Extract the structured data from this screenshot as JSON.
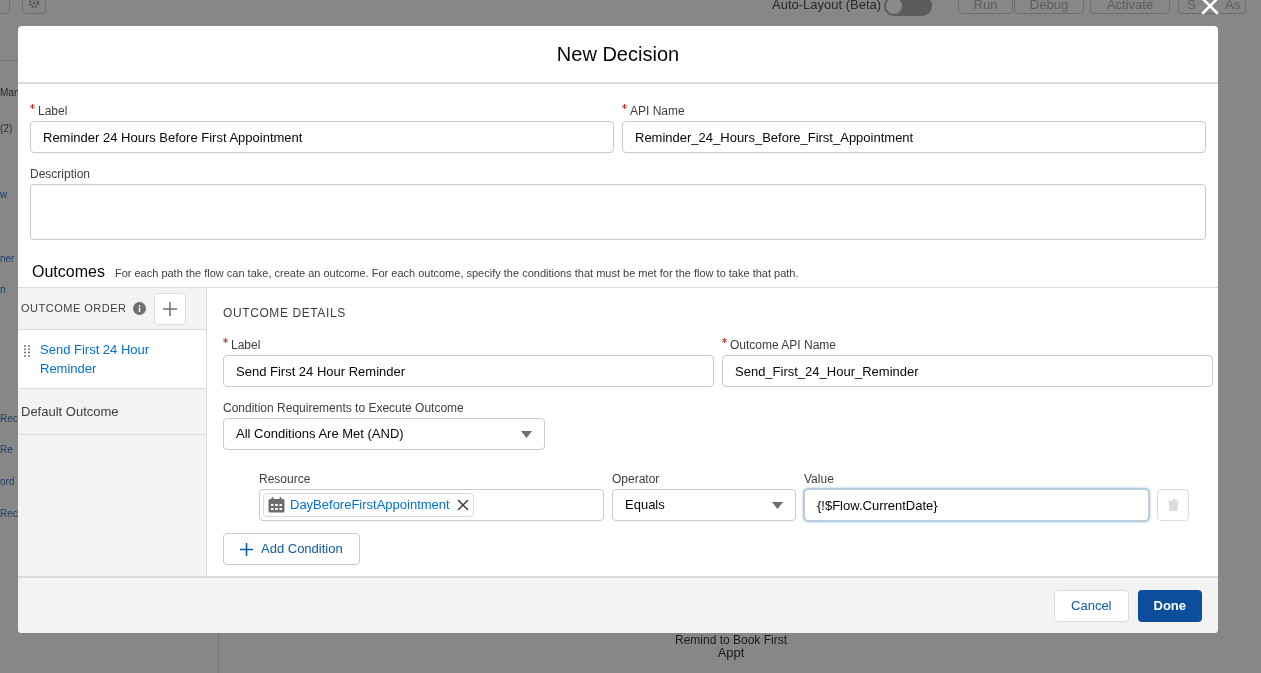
{
  "background": {
    "toolbar": {
      "auto_layout_label": "Auto-Layout (Beta)",
      "auto_layout_on": false,
      "buttons": [
        {
          "label": "Run"
        },
        {
          "label": "Debug"
        },
        {
          "label": "Activate"
        }
      ],
      "save_as_parts": [
        "S",
        "As"
      ]
    },
    "left_fragments": [
      {
        "text": "Man",
        "kind": "plain"
      },
      {
        "text": "(2)",
        "kind": "plain"
      },
      {
        "text": "w",
        "kind": "link"
      },
      {
        "text": "ner",
        "kind": "link"
      },
      {
        "text": "n",
        "kind": "link"
      },
      {
        "text": "Rec",
        "kind": "link"
      },
      {
        "text": "Re",
        "kind": "link"
      },
      {
        "text": "ord",
        "kind": "link"
      },
      {
        "text": "Rec",
        "kind": "link"
      }
    ],
    "canvas_node_label": [
      "Remind to Book First",
      "Appt"
    ]
  },
  "modal": {
    "title": "New Decision",
    "label": {
      "label": "Label",
      "required": true,
      "value": "Reminder 24 Hours Before First Appointment"
    },
    "api_name": {
      "label": "API Name",
      "required": true,
      "value": "Reminder_24_Hours_Before_First_Appointment"
    },
    "description": {
      "label": "Description"
    },
    "outcomes": {
      "heading": "Outcomes",
      "help": "For each path the flow can take, create an outcome. For each outcome, specify the conditions that must be met for the flow to take that path.",
      "order_heading": "OUTCOME ORDER",
      "items": [
        {
          "label": "Send First 24 Hour Reminder",
          "selected": true
        },
        {
          "label": "Default Outcome",
          "selected": false
        }
      ],
      "details": {
        "heading": "OUTCOME DETAILS",
        "label": {
          "label": "Label",
          "required": true,
          "value": "Send First 24 Hour Reminder"
        },
        "api_name": {
          "label": "Outcome API Name",
          "required": true,
          "value": "Send_First_24_Hour_Reminder"
        },
        "requirements": {
          "label": "Condition Requirements to Execute Outcome",
          "value": "All Conditions Are Met (AND)"
        },
        "conditions": [
          {
            "resource_label": "Resource",
            "resource": "DayBeforeFirstAppointment",
            "operator_label": "Operator",
            "operator": "Equals",
            "value_label": "Value",
            "value": "{!$Flow.CurrentDate}",
            "focused": true
          }
        ],
        "add_button": "Add Condition"
      }
    },
    "footer": {
      "cancel": "Cancel",
      "done": "Done"
    }
  }
}
